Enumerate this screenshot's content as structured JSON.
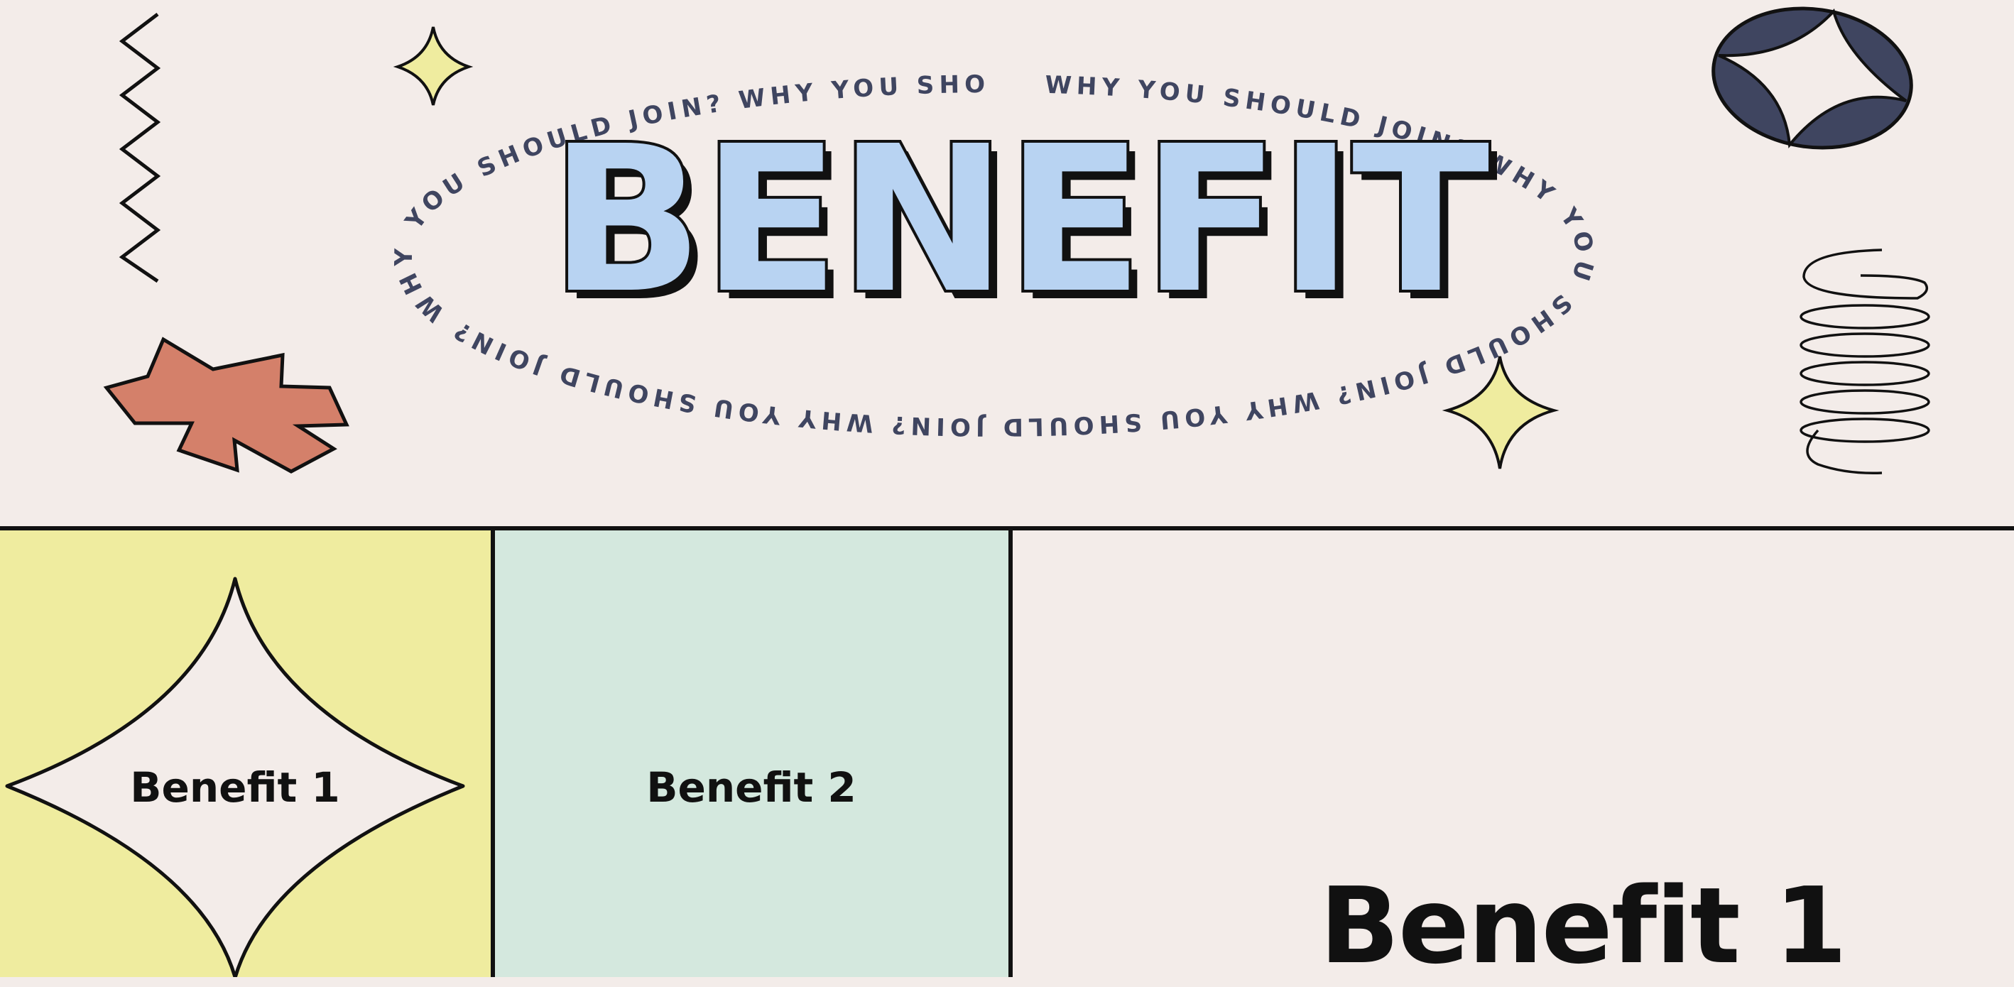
{
  "hero": {
    "title": "BENEFIT",
    "circular_text": "WHY YOU SHOULD JOIN?",
    "title_color": "#b8d3f2",
    "background": "#f3ece9"
  },
  "panels": [
    {
      "label": "Benefit 1",
      "color": "#efec9f"
    },
    {
      "label": "Benefit 2",
      "color": "#d4e8de"
    },
    {
      "label": "Benefit 1",
      "color": "#f3ece9"
    }
  ],
  "decorations": {
    "zigzag": "zigzag-icon",
    "asterisk": "orange-asterisk-icon",
    "star_small": "yellow-sparkle-icon",
    "oval_star": "navy-oval-star-icon",
    "spring": "spring-coil-icon"
  },
  "colors": {
    "yellow": "#efec9f",
    "mint": "#d4e8de",
    "orange": "#d4806a",
    "navy": "#3f4560",
    "outline": "#111111"
  }
}
